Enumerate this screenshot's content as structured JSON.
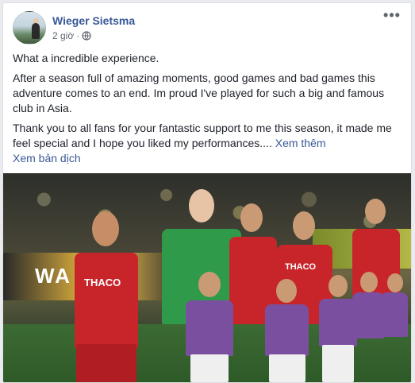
{
  "post": {
    "author": "Wieger Sietsma",
    "time": "2 giờ",
    "privacy_icon": "globe-icon",
    "more_icon": "more-dots-icon",
    "more_label": "•••",
    "text_lines": [
      "What a incredible experience.",
      "After a season full of amazing moments, good games and bad games this adventure comes to an end. Im proud I've played for such a big and famous club in Asia.",
      "Thank you to all fans for your fantastic support to me this season, it made me feel special and I hope you liked my performances...."
    ],
    "see_more": "Xem thêm",
    "translate": "Xem bản dịch"
  },
  "photo": {
    "description_icon": "team-lineup-photo",
    "board_text": "WA",
    "jersey_text": "THACO"
  },
  "colors": {
    "link": "#385898",
    "text": "#1d2129",
    "meta": "#616770",
    "background": "#e9ebee"
  }
}
